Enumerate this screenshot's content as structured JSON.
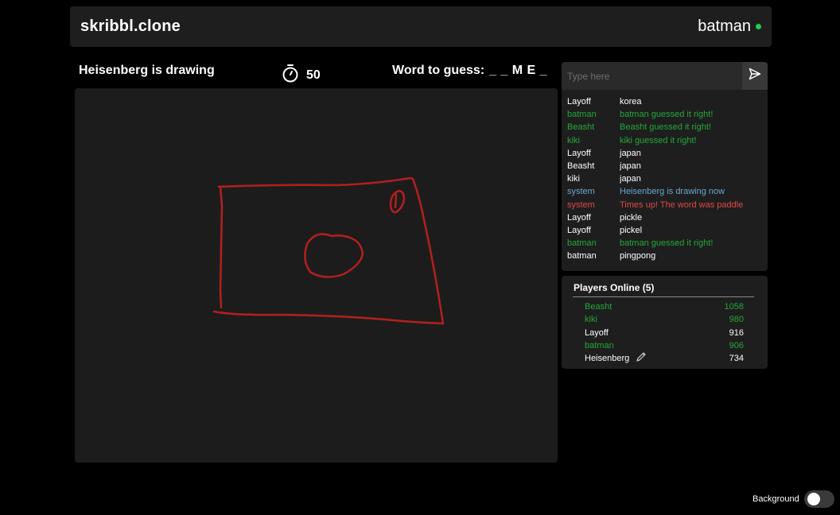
{
  "header": {
    "brand": "skribbl.clone",
    "username": "batman",
    "online_color": "#1fcf4b",
    "online_icon": "online-status-dot"
  },
  "game": {
    "drawing_label": "Heisenberg is drawing",
    "timer_icon": "stopwatch-icon",
    "timer_value": "50",
    "word_label": "Word to guess:",
    "word_hint": "_ _ M E _ _"
  },
  "canvas": {
    "stroke_color": "#b51e1e",
    "background": "#1c1c1c"
  },
  "chat": {
    "input_placeholder": "Type here",
    "input_value": "",
    "send_icon": "send-icon",
    "messages": [
      {
        "who": "Layoff",
        "text": "korea",
        "color": "#ffffff"
      },
      {
        "who": "batman",
        "text": "batman guessed it right!",
        "color": "#23a83a"
      },
      {
        "who": "Beasht",
        "text": "Beasht guessed it right!",
        "color": "#23a83a"
      },
      {
        "who": "kiki",
        "text": "kiki guessed it right!",
        "color": "#23a83a"
      },
      {
        "who": "Layoff",
        "text": "japan",
        "color": "#ffffff"
      },
      {
        "who": "Beasht",
        "text": "japan",
        "color": "#ffffff"
      },
      {
        "who": "kiki",
        "text": "japan",
        "color": "#ffffff"
      },
      {
        "who": "system",
        "text": "Heisenberg is drawing now",
        "color": "#6ba7d6"
      },
      {
        "who": "system",
        "text": "Times up! The word was paddle",
        "color": "#e04848"
      },
      {
        "who": "Layoff",
        "text": "pickle",
        "color": "#ffffff"
      },
      {
        "who": "Layoff",
        "text": "pickel",
        "color": "#ffffff"
      },
      {
        "who": "batman",
        "text": "batman guessed it right!",
        "color": "#23a83a"
      },
      {
        "who": "batman",
        "text": "pingpong",
        "color": "#ffffff"
      }
    ]
  },
  "players": {
    "title": "Players Online (5)",
    "list": [
      {
        "name": "Beasht",
        "score": "1058",
        "color": "#23a83a",
        "drawing": false
      },
      {
        "name": "kiki",
        "score": "980",
        "color": "#23a83a",
        "drawing": false
      },
      {
        "name": "Layoff",
        "score": "916",
        "color": "#ffffff",
        "drawing": false
      },
      {
        "name": "batman",
        "score": "906",
        "color": "#23a83a",
        "drawing": false
      },
      {
        "name": "Heisenberg",
        "score": "734",
        "color": "#ffffff",
        "drawing": true
      }
    ],
    "drawing_icon": "pencil-icon"
  },
  "footer": {
    "background_label": "Background",
    "background_on": false
  }
}
